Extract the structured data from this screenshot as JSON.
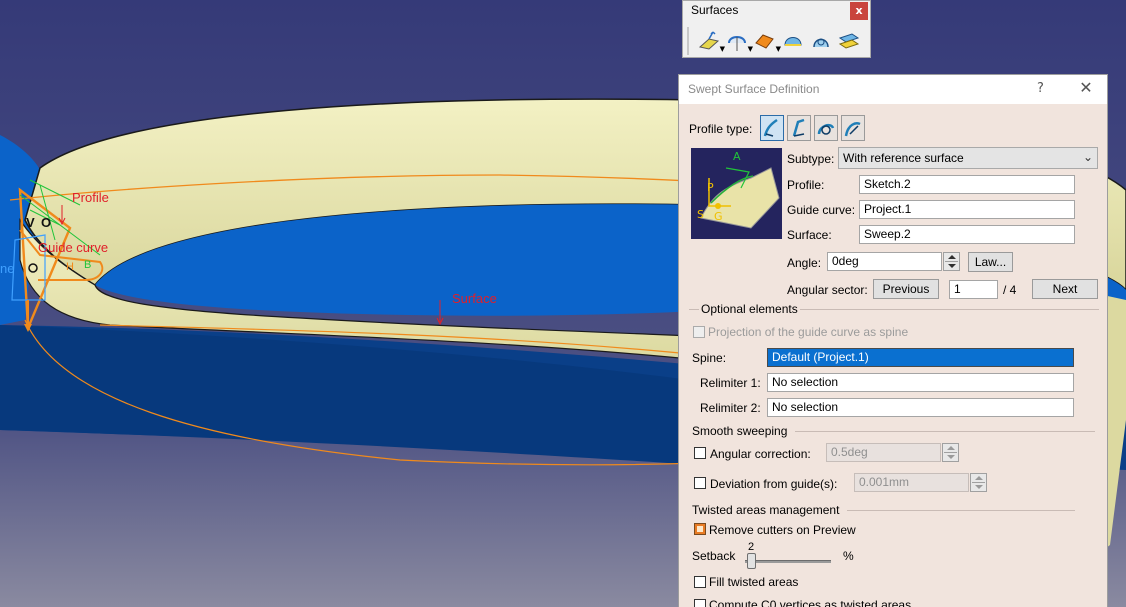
{
  "viewport": {
    "labels": {
      "profile": "Profile",
      "guide_curve": "Guide curve",
      "surface": "Surface",
      "v": "V",
      "o": "O",
      "ne": "ne",
      "h": "H",
      "b": "B"
    },
    "colors": {
      "background": "#3b3f78",
      "surface_top": "#eceab9",
      "surface_blue": "#0b63c9",
      "surface_dark": "#0a3f88",
      "curve_orange": "#f08a1c",
      "label_red": "#e0202a"
    }
  },
  "toolbar": {
    "title": "Surfaces",
    "close_label": "x",
    "buttons": [
      "extrude-icon",
      "revolve-icon",
      "sweep-icon",
      "fill-icon",
      "multi-section-icon",
      "blend-icon"
    ]
  },
  "dialog": {
    "title": "Swept Surface Definition",
    "help_label": "?",
    "close_label": "✕",
    "profile_type_label": "Profile type:",
    "subtype_label": "Subtype:",
    "subtype_value": "With reference surface",
    "profile_label": "Profile:",
    "profile_value": "Sketch.2",
    "guide_curve_label": "Guide curve:",
    "guide_curve_value": "Project.1",
    "surface_label": "Surface:",
    "surface_value": "Sweep.2",
    "angle_label": "Angle:",
    "angle_value": "0deg",
    "law_button": "Law...",
    "angular_sector_label": "Angular sector:",
    "previous_button": "Previous",
    "sector_value": "1",
    "sector_total": "/ 4",
    "next_button": "Next",
    "preview_labels": {
      "a": "A",
      "p": "P",
      "s": "S",
      "g": "G"
    },
    "optional": {
      "header": "Optional elements",
      "projection_label": "Projection of the guide curve as spine",
      "spine_label": "Spine:",
      "spine_value": "Default (Project.1)",
      "relimiter1_label": "Relimiter 1:",
      "relimiter1_value": "No selection",
      "relimiter2_label": "Relimiter 2:",
      "relimiter2_value": "No selection"
    },
    "smooth": {
      "header": "Smooth sweeping",
      "angular_correction_label": "Angular correction:",
      "angular_correction_value": "0.5deg",
      "deviation_label": "Deviation from guide(s):",
      "deviation_value": "0.001mm"
    },
    "twisted": {
      "header": "Twisted areas management",
      "remove_cutters_label": "Remove cutters on Preview",
      "remove_cutters_checked": true,
      "setback_label": "Setback",
      "setback_value": "2",
      "setback_unit": "%",
      "setback_fraction": 0.02,
      "fill_twisted_label": "Fill twisted areas",
      "compute_c0_label": "Compute C0 vertices as twisted areas"
    }
  }
}
